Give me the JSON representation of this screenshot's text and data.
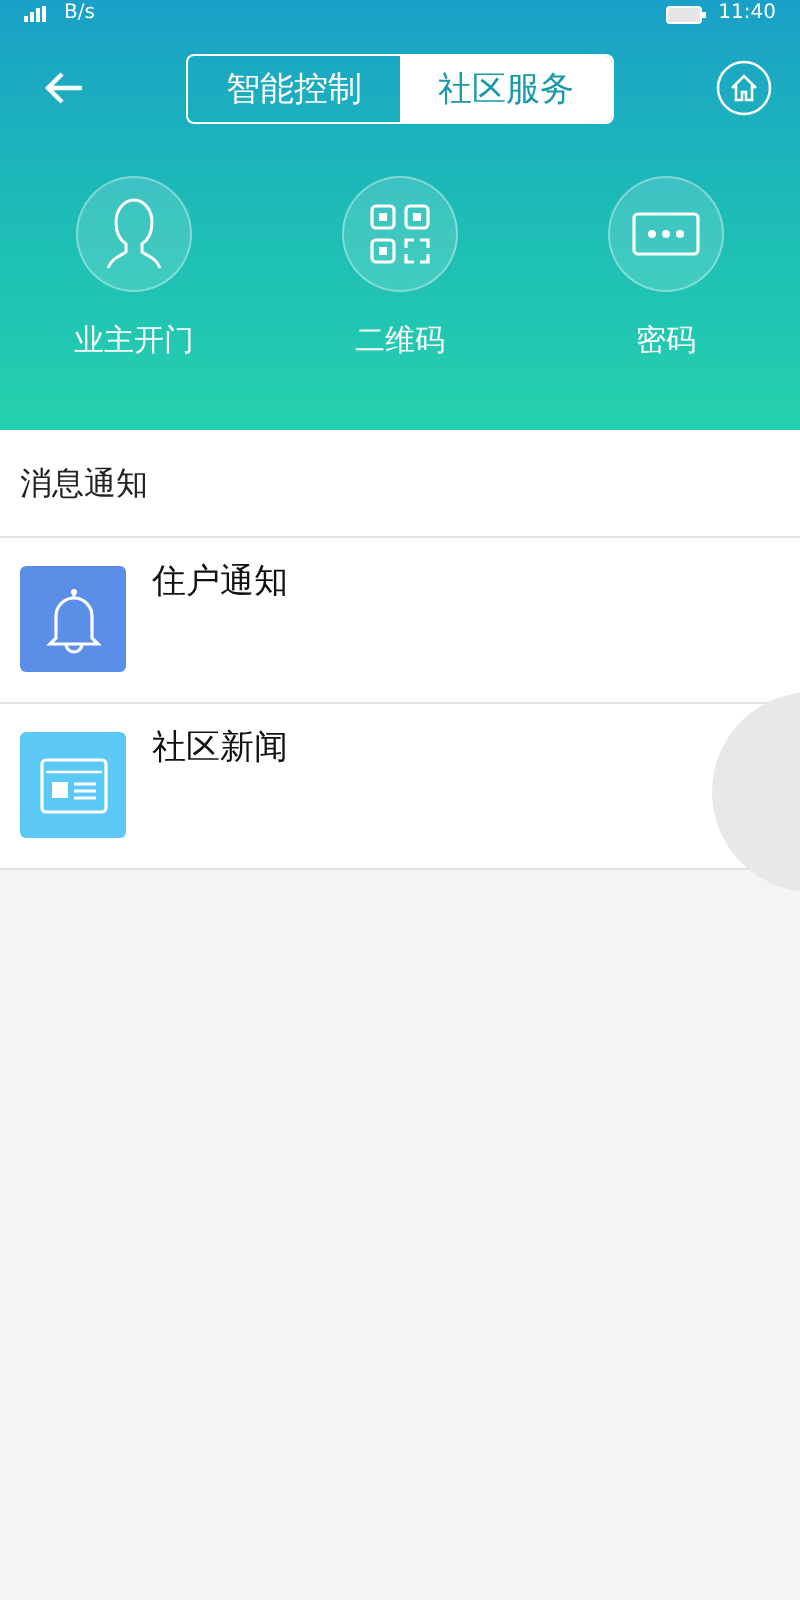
{
  "status_bar": {
    "speed": "B/s",
    "time": "11:40"
  },
  "tabs": [
    {
      "label": "智能控制",
      "selected": false
    },
    {
      "label": "社区服务",
      "selected": true
    }
  ],
  "quick_actions": [
    {
      "kind": "person",
      "label": "业主开门"
    },
    {
      "kind": "qrcode",
      "label": "二维码"
    },
    {
      "kind": "password",
      "label": "密码"
    }
  ],
  "section_title": "消息通知",
  "messages": [
    {
      "kind": "bell",
      "title": "住户通知",
      "color": "#5b8ee6"
    },
    {
      "kind": "news",
      "title": "社区新闻",
      "color": "#5cc8f5"
    }
  ]
}
